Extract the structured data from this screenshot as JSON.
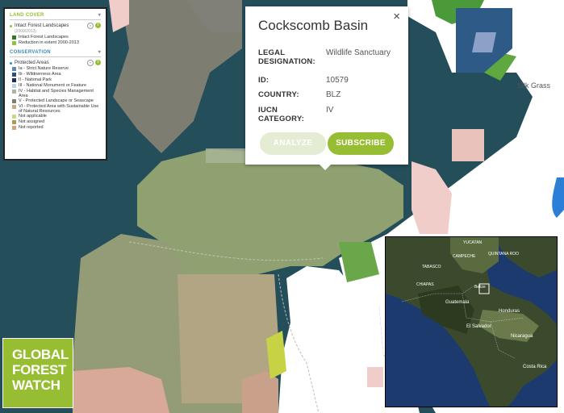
{
  "legend": {
    "land_cover": {
      "heading": "LAND COVER",
      "layer_name": "Intact Forest Landscapes",
      "layer_sub": "(2000/2013)",
      "items": [
        {
          "label": "Intact Forest Landscapes",
          "color": "#2d7a28"
        },
        {
          "label": "Reduction in extent 2000-2013",
          "color": "#8cc63f"
        }
      ]
    },
    "conservation": {
      "heading": "CONSERVATION",
      "layer_name": "Protected Areas",
      "items": [
        {
          "label": "Ia - Strict Nature Reserve",
          "color": "#5f8ab5"
        },
        {
          "label": "Ib - Wildnerness Area",
          "color": "#2a4f7c"
        },
        {
          "label": "II - National Park",
          "color": "#1c2e5b"
        },
        {
          "label": "III - National Monument or Feature",
          "color": "#b9d3e6"
        },
        {
          "label": "IV - Habitat and Species Management Area",
          "color": "#aab79f"
        },
        {
          "label": "V - Protected Landscape or Seascape",
          "color": "#7e7e74"
        },
        {
          "label": "VI - Protected Area with Sustainable Use of Natural Resources",
          "color": "#c8a78d"
        },
        {
          "label": "Not applicable",
          "color": "#c7d983"
        },
        {
          "label": "Not assigned",
          "color": "#a99d4f"
        },
        {
          "label": "Not reported",
          "color": "#d3a27e"
        }
      ]
    }
  },
  "popup": {
    "title": "Cockscomb Basin",
    "close_label": "×",
    "rows": [
      {
        "key": "LEGAL DESIGNATION:",
        "value": "Wildlife Sanctuary"
      },
      {
        "key": "ID:",
        "value": "10579"
      },
      {
        "key": "COUNTRY:",
        "value": "BLZ"
      },
      {
        "key": "IUCN CATEGORY:",
        "value": "IV"
      }
    ],
    "analyze_label": "ANALYZE",
    "subscribe_label": "SUBSCRIBE"
  },
  "logo": {
    "line1": "GLOBAL",
    "line2": "FOREST",
    "line3": "WATCH"
  },
  "map": {
    "place_label": "Silk Grass"
  },
  "inset": {
    "labels": [
      "YUCATAN",
      "CAMPECHE",
      "QUINTANA ROO",
      "TABASCO",
      "CHIAPAS",
      "Belize",
      "Guatemala",
      "Honduras",
      "El Salvador",
      "Nicaragua",
      "Costa Rica"
    ]
  },
  "colors": {
    "gfw_green": "#97be32",
    "conservation_blue": "#3b8bb5"
  }
}
